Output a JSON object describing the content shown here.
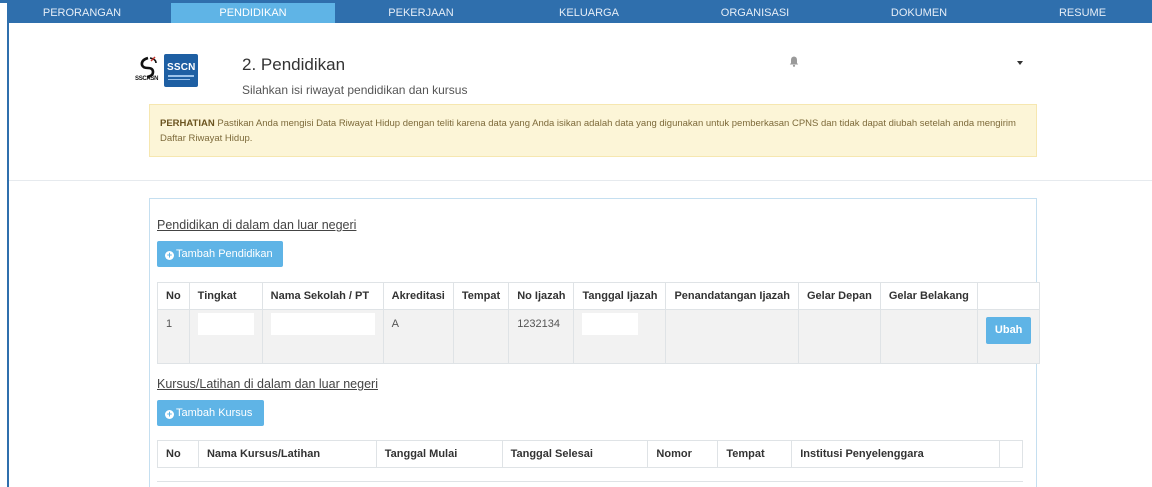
{
  "nav": {
    "items": [
      {
        "label": "PERORANGAN"
      },
      {
        "label": "PENDIDIKAN"
      },
      {
        "label": "PEKERJAAN"
      },
      {
        "label": "KELUARGA"
      },
      {
        "label": "ORGANISASI"
      },
      {
        "label": "DOKUMEN"
      },
      {
        "label": "RESUME"
      }
    ],
    "active_index": 1
  },
  "header": {
    "logo_sscasn": "SSCASN",
    "logo_sscn": "SSCN",
    "title": "2. Pendidikan",
    "subtitle": "Silahkan isi riwayat pendidikan dan kursus"
  },
  "alert": {
    "label": "PERHATIAN",
    "text": " Pastikan Anda mengisi Data Riwayat Hidup dengan teliti karena data yang Anda isikan adalah data yang digunakan untuk pemberkasan CPNS dan tidak dapat diubah setelah anda mengirim Daftar Riwayat Hidup."
  },
  "education": {
    "section_title": "Pendidikan di dalam dan luar negeri",
    "add_button": "Tambah Pendidikan",
    "columns": [
      "No",
      "Tingkat",
      "Nama Sekolah / PT",
      "Akreditasi",
      "Tempat",
      "No Ijazah",
      "Tanggal Ijazah",
      "Penandatangan Ijazah",
      "Gelar Depan",
      "Gelar Belakang",
      ""
    ],
    "rows": [
      {
        "no": "1",
        "tingkat": "",
        "nama": "",
        "akreditasi": "A",
        "tempat": "",
        "no_ijazah": "1232134",
        "tanggal": "",
        "penandatangan": "",
        "gelar_depan": "",
        "gelar_belakang": "",
        "action": "Ubah"
      }
    ]
  },
  "courses": {
    "section_title": "Kursus/Latihan di dalam dan luar negeri",
    "add_button": "Tambah Kursus",
    "columns": [
      "No",
      "Nama Kursus/Latihan",
      "Tanggal Mulai",
      "Tanggal Selesai",
      "Nomor",
      "Tempat",
      "Institusi Penyelenggara",
      ""
    ]
  },
  "colors": {
    "nav_bg": "#2f6fad",
    "nav_active": "#5fb4e6",
    "button": "#5fb4e6",
    "alert_bg": "#fcf5d7"
  }
}
